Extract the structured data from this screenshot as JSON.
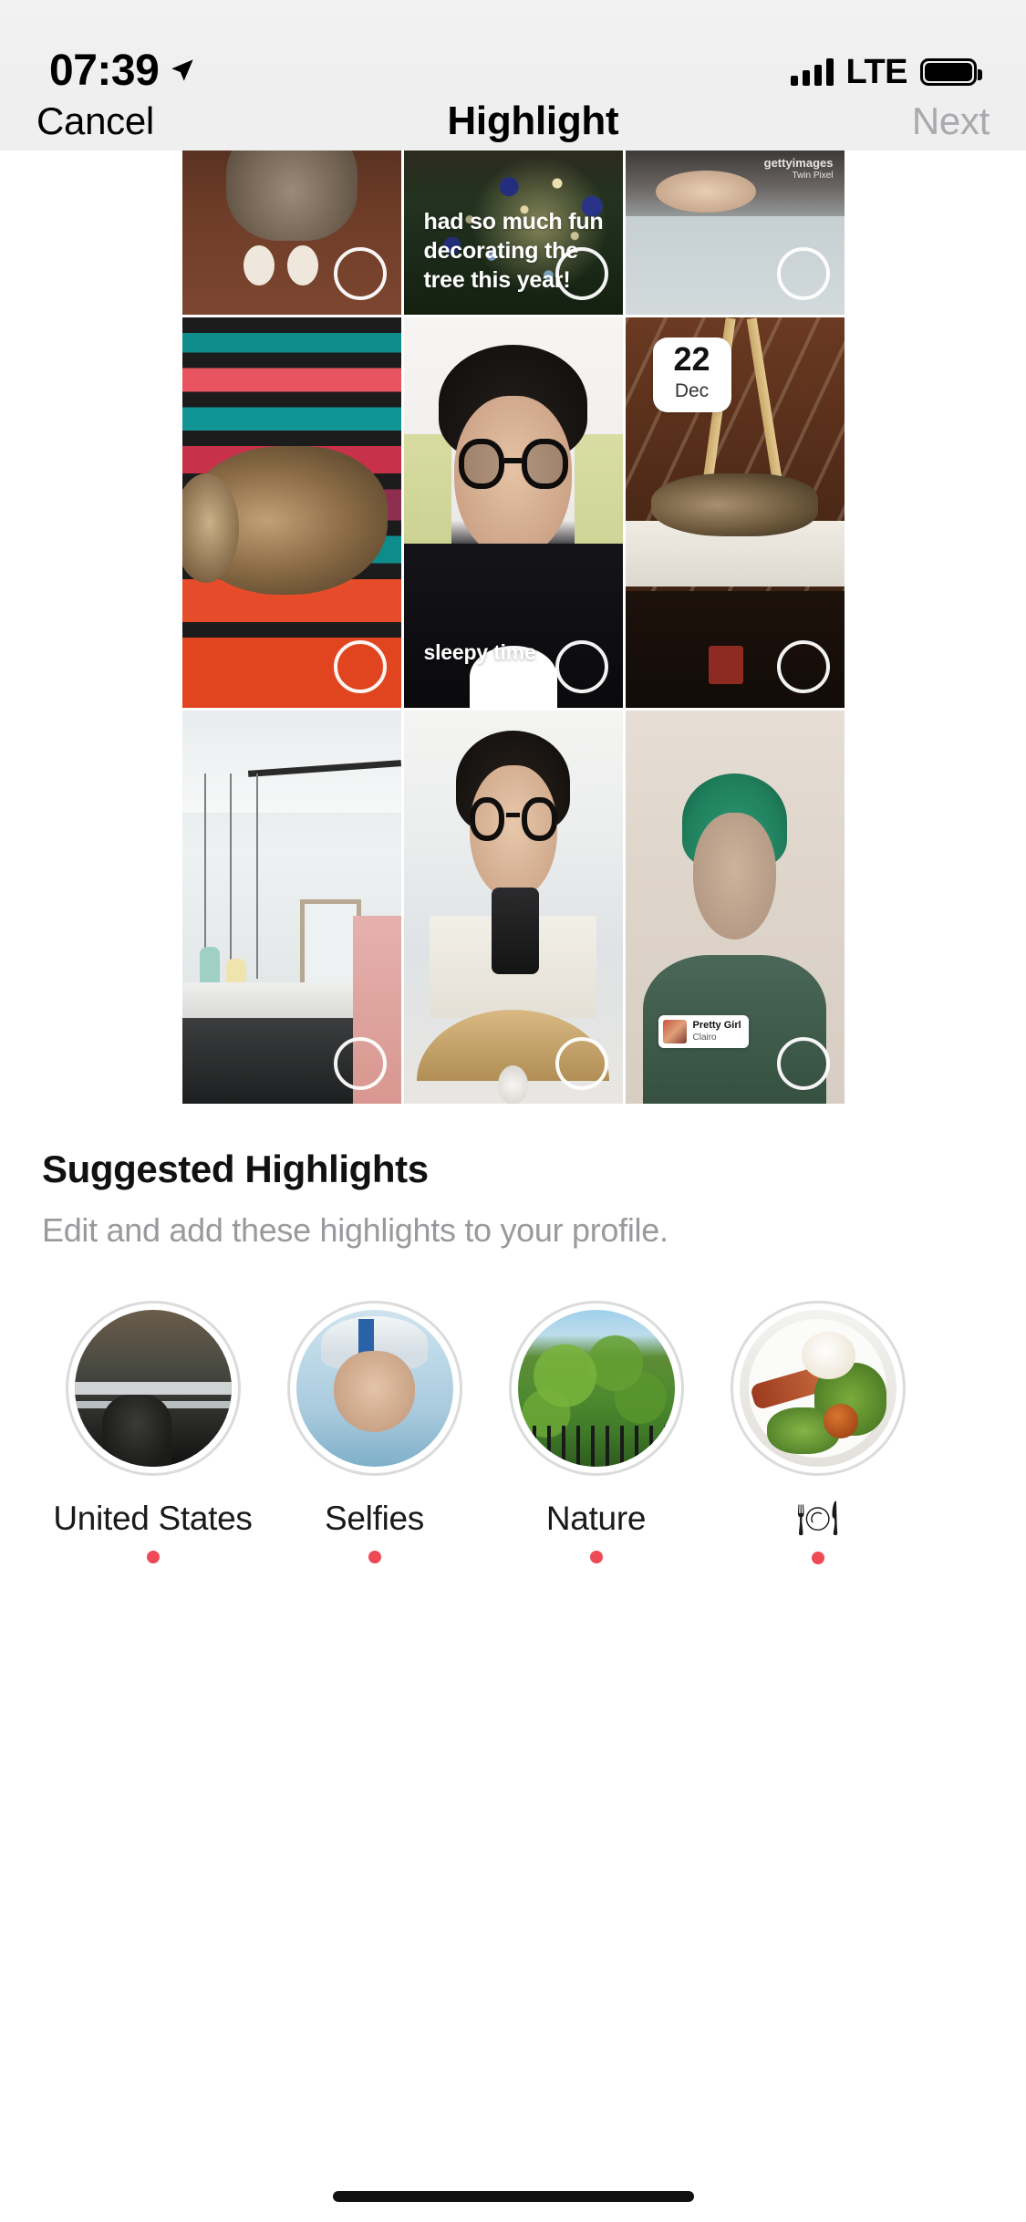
{
  "status_bar": {
    "time": "07:39",
    "location_icon": "location-arrow-icon",
    "signal_icon": "cellular-bars-icon",
    "network": "LTE",
    "battery_icon": "battery-full-icon"
  },
  "nav": {
    "cancel_label": "Cancel",
    "title": "Highlight",
    "next_label": "Next",
    "next_enabled": false
  },
  "grid": {
    "rows": 3,
    "columns": 3,
    "items": [
      {
        "id": "story-1",
        "scene": "cat-on-wood-floor",
        "selected": false,
        "overlay_text": null,
        "select_ring": "selection-circle"
      },
      {
        "id": "story-2",
        "scene": "christmas-tree",
        "selected": false,
        "overlay_text": "had so much fun decorating the tree this year!",
        "select_ring": "selection-circle"
      },
      {
        "id": "story-3",
        "scene": "hospital-bed",
        "selected": false,
        "overlay_text": null,
        "watermark": "gettyimages",
        "watermark_sub": "Twin Pixel",
        "select_ring": "selection-circle"
      },
      {
        "id": "story-4",
        "scene": "cat-on-striped-blanket",
        "selected": false,
        "overlay_text": null,
        "select_ring": "selection-circle"
      },
      {
        "id": "story-5",
        "scene": "man-with-glasses-eyes-closed",
        "selected": false,
        "overlay_text": "sleepy time",
        "select_ring": "selection-circle"
      },
      {
        "id": "story-6",
        "scene": "cat-on-shelf",
        "selected": false,
        "date_sticker": {
          "day": "22",
          "month": "Dec"
        },
        "select_ring": "selection-circle"
      },
      {
        "id": "story-7",
        "scene": "room-with-hanging-lamps",
        "selected": false,
        "overlay_text": null,
        "select_ring": "selection-circle"
      },
      {
        "id": "story-8",
        "scene": "mirror-selfie",
        "selected": false,
        "overlay_text": null,
        "select_ring": "selection-circle"
      },
      {
        "id": "story-9",
        "scene": "man-green-hair-filter",
        "selected": false,
        "music_sticker": {
          "title": "Pretty Girl",
          "artist": "Clairo"
        },
        "select_ring": "selection-circle"
      }
    ]
  },
  "suggested": {
    "title": "Suggested Highlights",
    "subtitle": "Edit and add these highlights to your profile.",
    "dot_color": "#ed4956",
    "items": [
      {
        "label": "United States",
        "thumb": "street-photo-thumb",
        "has_dot": true
      },
      {
        "label": "Selfies",
        "thumb": "selfie-photo-thumb",
        "has_dot": true
      },
      {
        "label": "Nature",
        "thumb": "nature-photo-thumb",
        "has_dot": true
      },
      {
        "label": "🍽",
        "thumb": "food-photo-thumb",
        "has_dot": true
      }
    ]
  },
  "home_indicator": "home-indicator"
}
